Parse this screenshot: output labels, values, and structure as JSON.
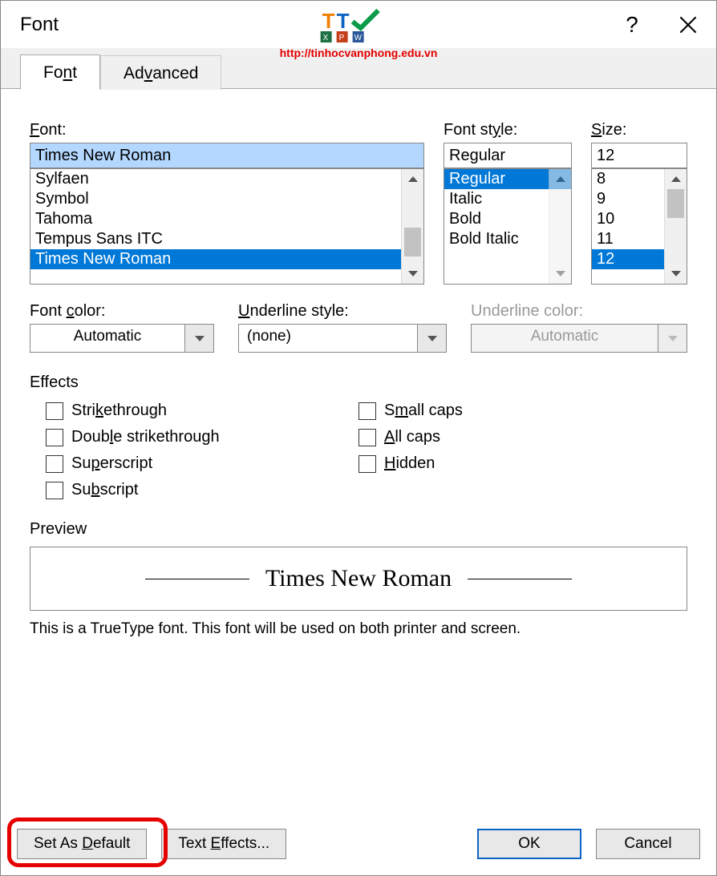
{
  "title": "Font",
  "watermark_url": "http://tinhocvanphong.edu.vn",
  "tabs": {
    "font": "Font",
    "advanced": "Advanced"
  },
  "labels": {
    "font": "Font:",
    "fontstyle": "Font style:",
    "size": "Size:",
    "fontcolor": "Font color:",
    "underlinestyle": "Underline style:",
    "underlinecolor": "Underline color:",
    "effects": "Effects",
    "preview": "Preview"
  },
  "font_input": "Times New Roman",
  "font_list": [
    "Sylfaen",
    "Symbol",
    "Tahoma",
    "Tempus Sans ITC",
    "Times New Roman"
  ],
  "font_selected": "Times New Roman",
  "style_input": "Regular",
  "style_list": [
    "Regular",
    "Italic",
    "Bold",
    "Bold Italic"
  ],
  "style_selected": "Regular",
  "size_input": "12",
  "size_list": [
    "8",
    "9",
    "10",
    "11",
    "12"
  ],
  "size_selected": "12",
  "fontcolor_value": "Automatic",
  "underlinestyle_value": "(none)",
  "underlinecolor_value": "Automatic",
  "effects": {
    "strike": "Strikethrough",
    "dstrike": "Double strikethrough",
    "sup": "Superscript",
    "sub": "Subscript",
    "smallcaps": "Small caps",
    "allcaps": "All caps",
    "hidden": "Hidden"
  },
  "preview_text": "Times New Roman",
  "hint": "This is a TrueType font. This font will be used on both printer and screen.",
  "buttons": {
    "setdefault": "Set As Default",
    "texteffects": "Text Effects...",
    "ok": "OK",
    "cancel": "Cancel"
  }
}
